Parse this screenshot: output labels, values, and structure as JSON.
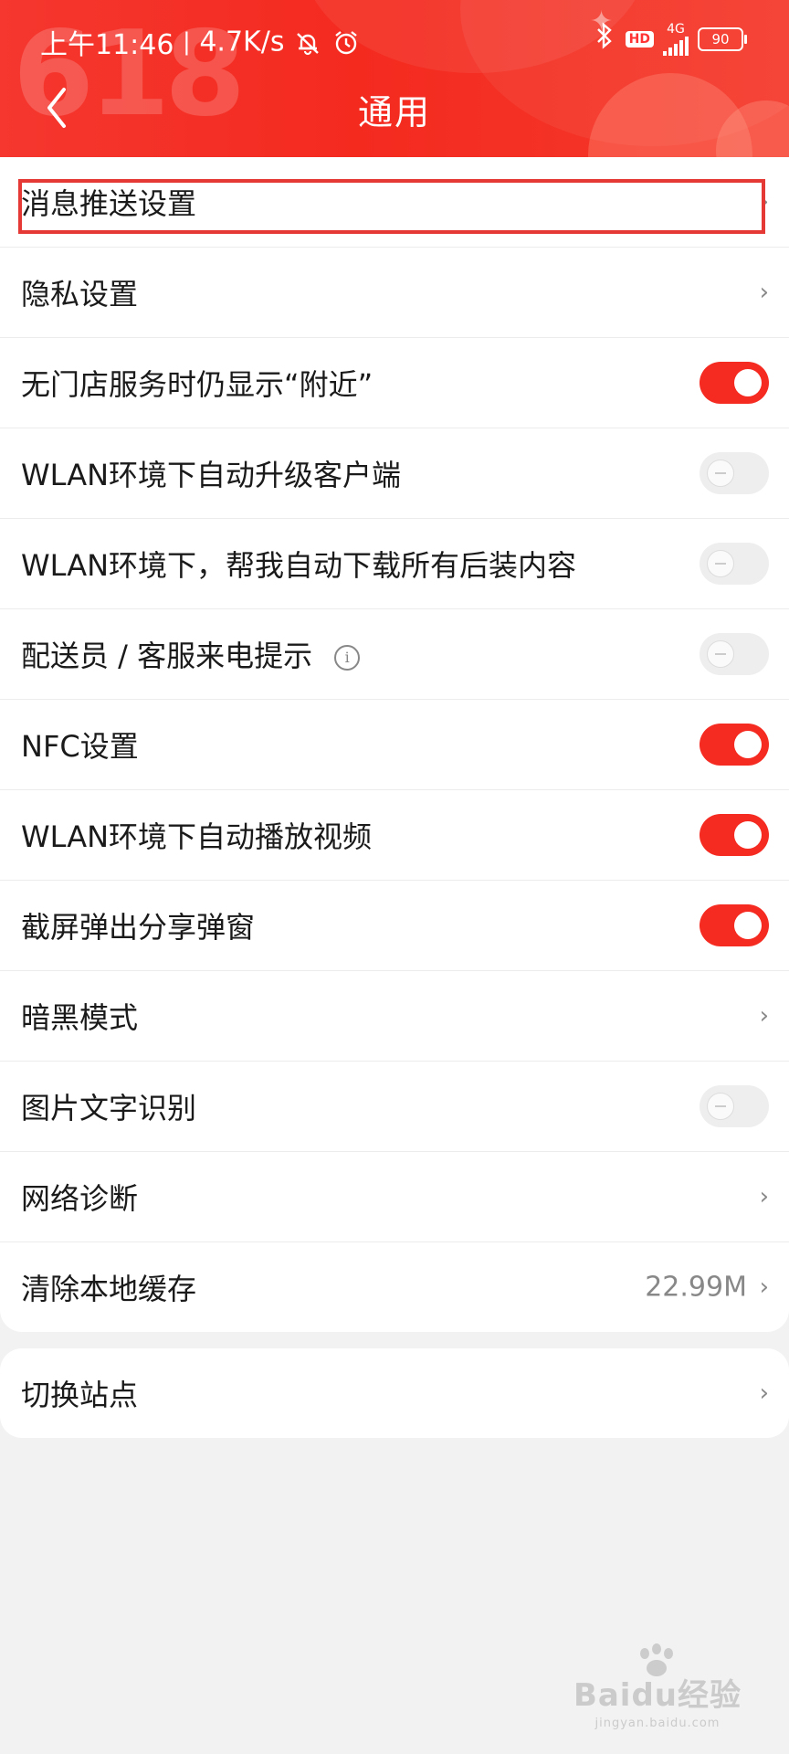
{
  "status_bar": {
    "time": "上午11:46",
    "separator": "|",
    "net_speed": "4.7K/s",
    "hd": "HD",
    "network": "4G",
    "battery": "90"
  },
  "header": {
    "title": "通用",
    "decoration": "618"
  },
  "settings": [
    {
      "label": "消息推送设置",
      "control": "chevron"
    },
    {
      "label": "隐私设置",
      "control": "chevron"
    },
    {
      "label": "无门店服务时仍显示“附近”",
      "control": "toggle",
      "on": true
    },
    {
      "label": "WLAN环境下自动升级客户端",
      "control": "toggle",
      "on": false
    },
    {
      "label": "WLAN环境下，帮我自动下载所有后装内容",
      "control": "toggle",
      "on": false
    },
    {
      "label": "配送员 / 客服来电提示",
      "control": "toggle",
      "on": false,
      "info_icon": "i"
    },
    {
      "label": "NFC设置",
      "control": "toggle",
      "on": true
    },
    {
      "label": "WLAN环境下自动播放视频",
      "control": "toggle",
      "on": true
    },
    {
      "label": "截屏弹出分享弹窗",
      "control": "toggle",
      "on": true
    },
    {
      "label": "暗黑模式",
      "control": "chevron"
    },
    {
      "label": "图片文字识别",
      "control": "toggle",
      "on": false
    },
    {
      "label": "网络诊断",
      "control": "chevron"
    },
    {
      "label": "清除本地缓存",
      "control": "chevron",
      "value": "22.99M"
    }
  ],
  "site": {
    "label": "切换站点"
  },
  "chevron_glyph": "›",
  "watermark": {
    "main": "Baidu经验",
    "sub": "jingyan.baidu.com"
  },
  "colors": {
    "accent": "#f52a20",
    "header_bg": "#f42a1f",
    "page_bg": "#f2f2f2",
    "highlight": "#e53935"
  }
}
